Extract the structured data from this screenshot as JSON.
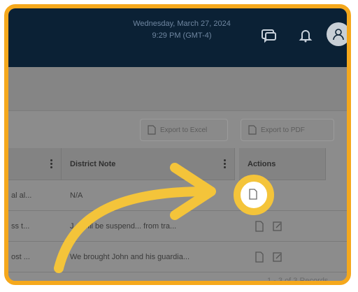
{
  "header": {
    "date": "Wednesday, March 27, 2024",
    "time": "9:29 PM (GMT-4)",
    "icons": [
      "chat-icon",
      "bell-icon",
      "user-icon"
    ]
  },
  "toolbar": {
    "export_excel": "Export to Excel",
    "export_pdf": "Export to PDF"
  },
  "table": {
    "columns": [
      "District Note",
      "Actions"
    ],
    "rows": [
      {
        "prev": "al al...",
        "note": "N/A"
      },
      {
        "prev": "ss t...",
        "note": "J... will be suspend... from tra..."
      },
      {
        "prev": "ost ...",
        "note": "We brought John and his guardia..."
      }
    ]
  },
  "footer": {
    "records": "1 - 3 of 3 Records"
  },
  "colors": {
    "accent": "#f5a81c",
    "arrow": "#f4c43a",
    "topbar": "#0b2135"
  }
}
